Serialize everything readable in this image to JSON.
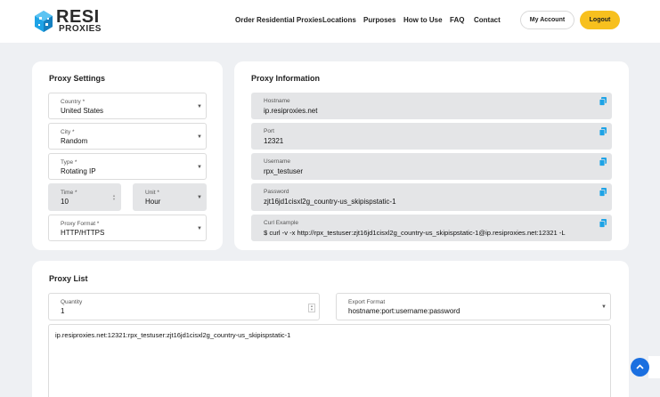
{
  "brand": {
    "name": "RESI",
    "sub": "PROXIES",
    "accent": "#f7c01e",
    "logo_blue": "#1ea3e6"
  },
  "nav": {
    "items": [
      "Order Residential Proxies",
      "Locations",
      "Purposes",
      "How to Use",
      "FAQ",
      "Contact"
    ],
    "account_label": "My Account",
    "logout_label": "Logout"
  },
  "settings": {
    "title": "Proxy Settings",
    "country": {
      "label": "Country *",
      "value": "United States"
    },
    "city": {
      "label": "City *",
      "value": "Random"
    },
    "type": {
      "label": "Type *",
      "value": "Rotating IP"
    },
    "time": {
      "label": "Time *",
      "value": "10"
    },
    "unit": {
      "label": "Unit *",
      "value": "Hour"
    },
    "format": {
      "label": "Proxy Format *",
      "value": "HTTP/HTTPS"
    }
  },
  "info": {
    "title": "Proxy Information",
    "hostname": {
      "label": "Hostname",
      "value": "ip.resiproxies.net"
    },
    "port": {
      "label": "Port",
      "value": "12321"
    },
    "username": {
      "label": "Username",
      "value": "rpx_testuser"
    },
    "password": {
      "label": "Password",
      "value": "zjt16jd1cisxl2g_country-us_skipispstatic-1"
    },
    "curl": {
      "label": "Curl Example",
      "value": "$ curl -v -x http://rpx_testuser:zjt16jd1cisxl2g_country-us_skipispstatic-1@ip.resiproxies.net:12321 -L"
    }
  },
  "list": {
    "title": "Proxy List",
    "quantity": {
      "label": "Quantity",
      "value": "1"
    },
    "export": {
      "label": "Export Format",
      "value": "hostname:port:username:password"
    },
    "output": "ip.resiproxies.net:12321:rpx_testuser:zjt16jd1cisxl2g_country-us_skipispstatic-1"
  }
}
